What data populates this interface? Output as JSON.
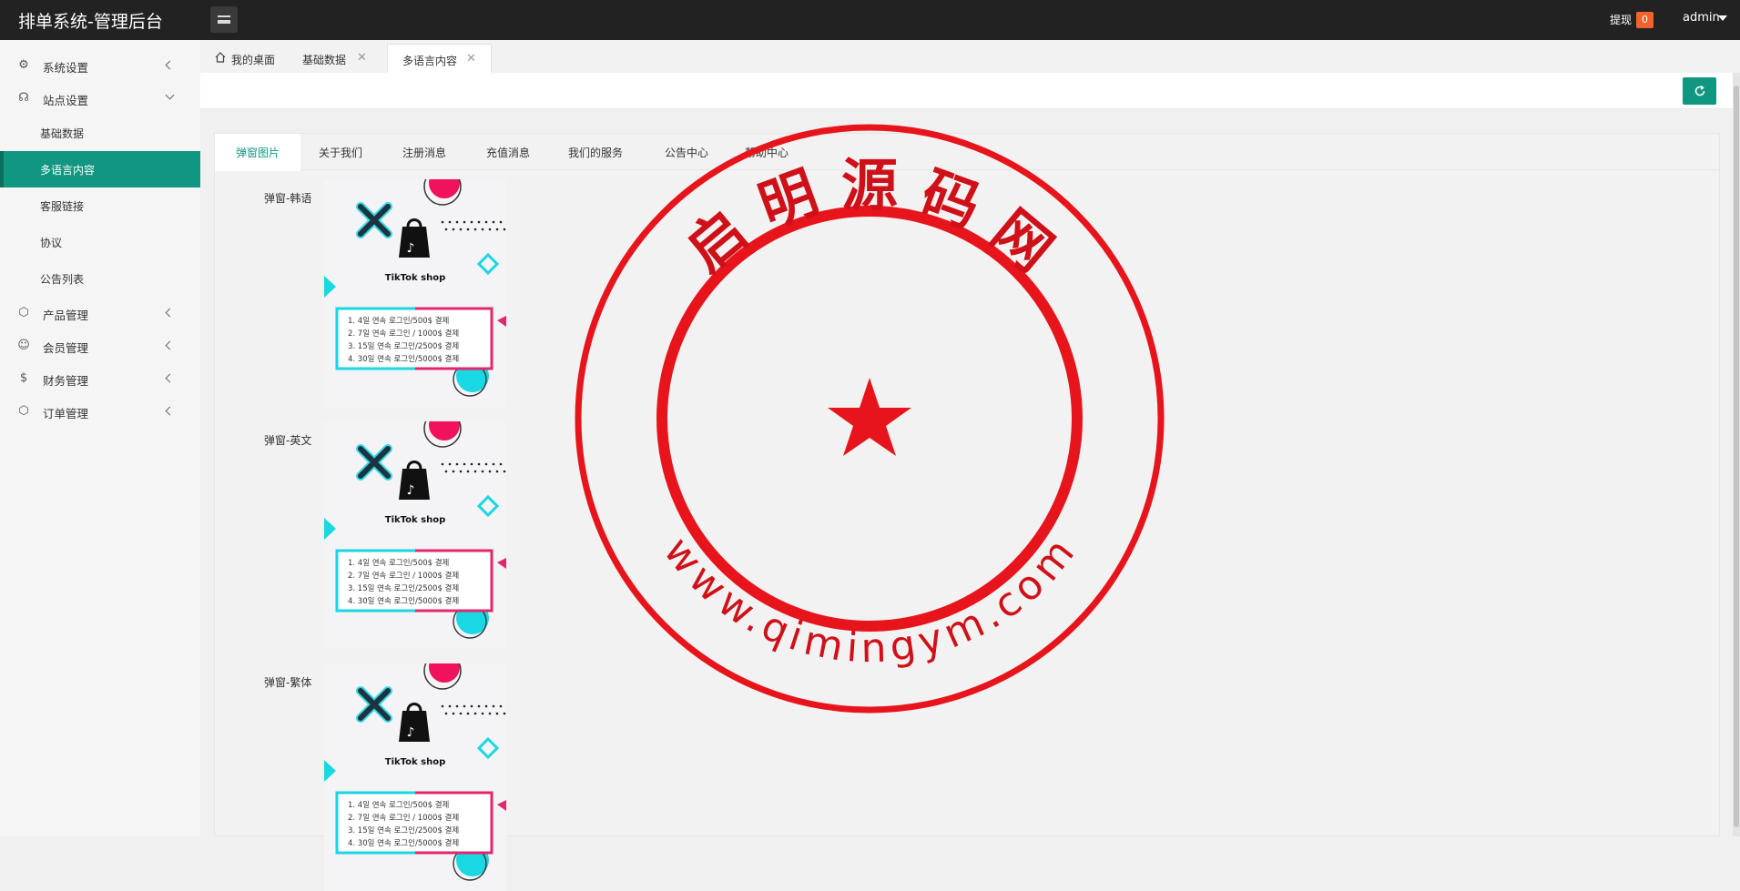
{
  "app": {
    "title": "排单系统-管理后台"
  },
  "header": {
    "withdraw_label": "提现",
    "withdraw_count": "0",
    "user": "admin"
  },
  "sidebar": {
    "groups": [
      {
        "label": "系统设置",
        "icon": "gear-icon"
      },
      {
        "label": "站点设置",
        "icon": "headset-icon"
      },
      {
        "label": "产品管理",
        "icon": "box-icon"
      },
      {
        "label": "会员管理",
        "icon": "user-icon"
      },
      {
        "label": "财务管理",
        "icon": "dollar-icon"
      },
      {
        "label": "订单管理",
        "icon": "box-icon"
      }
    ],
    "site_items": [
      {
        "label": "基础数据"
      },
      {
        "label": "多语言内容"
      },
      {
        "label": "客服链接"
      },
      {
        "label": "协议"
      },
      {
        "label": "公告列表"
      }
    ]
  },
  "page_tabs": [
    {
      "label": "我的桌面"
    },
    {
      "label": "基础数据"
    },
    {
      "label": "多语言内容"
    }
  ],
  "content_tabs": [
    {
      "label": "弹窗图片"
    },
    {
      "label": "关于我们"
    },
    {
      "label": "注册消息"
    },
    {
      "label": "充值消息"
    },
    {
      "label": "我们的服务"
    },
    {
      "label": "公告中心"
    },
    {
      "label": "帮助中心"
    }
  ],
  "popups": [
    {
      "label": "弹窗-韩语"
    },
    {
      "label": "弹窗-英文"
    },
    {
      "label": "弹窗-繁体"
    }
  ],
  "popup_image": {
    "brand": "TikTok shop",
    "lines": [
      "1. 4일 연속 로그인/500$ 결제",
      "2. 7일 연속 로그인 / 1000$ 결제",
      "3. 15일 연속 로그인/2500$ 결제",
      "4. 30일 연속 로그인/5000$ 결제"
    ]
  },
  "watermark": {
    "top_text": "启 明 源 码 网",
    "bottom_text": "www.qimingym.com"
  },
  "colors": {
    "accent": "#119681",
    "topbar": "#222222",
    "badge": "#f0632c",
    "seal": "#e8141b"
  }
}
